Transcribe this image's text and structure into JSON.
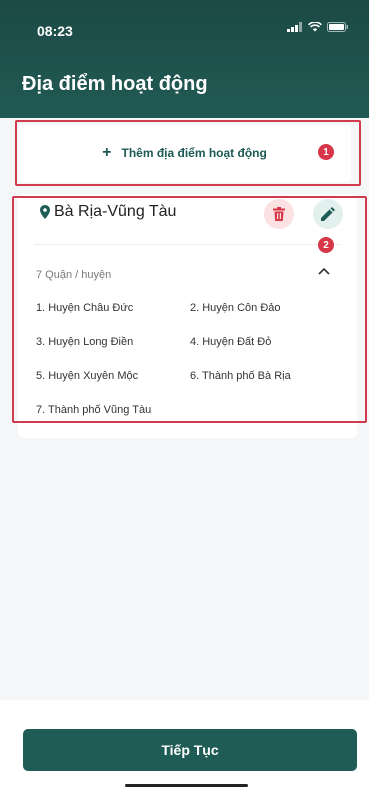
{
  "status_bar": {
    "time": "08:23"
  },
  "header": {
    "title": "Địa điểm hoạt động"
  },
  "add_location": {
    "plus": "+",
    "label": "Thêm địa điểm hoạt động"
  },
  "annotations": {
    "badge_1": "1",
    "badge_2": "2"
  },
  "location": {
    "name": "Bà Rịa-Vũng Tàu",
    "district_count": "7 Quận / huyện",
    "districts": [
      "1. Huyện Châu Đức",
      "2. Huyện Côn Đảo",
      "3. Huyện Long Điền",
      "4. Huyện Đất Đỏ",
      "5. Huyện Xuyên Mộc",
      "6. Thành phố Bà Rịa",
      "7. Thành phố Vũng Tàu"
    ]
  },
  "footer": {
    "continue_label": "Tiếp Tục"
  },
  "colors": {
    "brand": "#1f5c55",
    "annotation": "#d23a4d",
    "delete": "#d63648"
  },
  "icons": [
    "signal-icon",
    "wifi-icon",
    "battery-icon",
    "location-pin-icon",
    "trash-icon",
    "pencil-icon",
    "chevron-up-icon"
  ]
}
